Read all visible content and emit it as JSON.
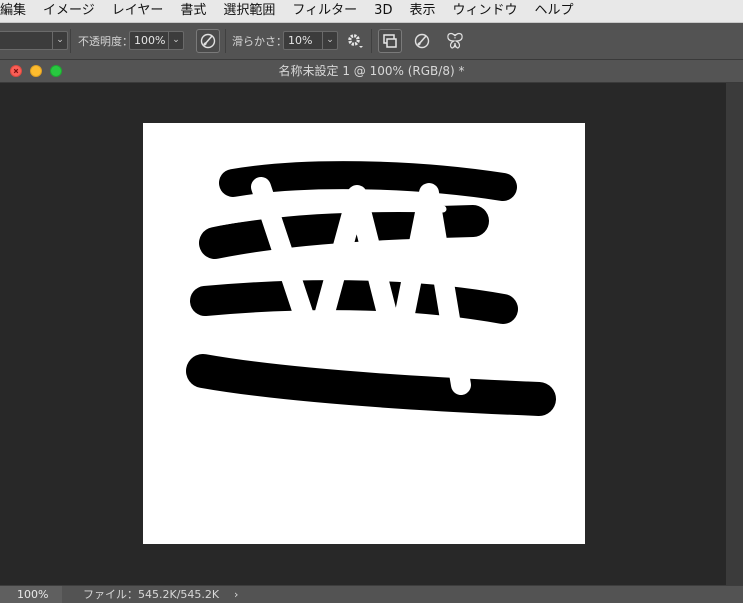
{
  "menubar": {
    "items": [
      "編集",
      "イメージ",
      "レイヤー",
      "書式",
      "選択範囲",
      "フィルター",
      "3D",
      "表示",
      "ウィンドウ",
      "ヘルプ"
    ]
  },
  "options": {
    "opacity_label": "不透明度：",
    "opacity_value": "100%",
    "smoothing_label": "滑らかさ：",
    "smoothing_value": "10%"
  },
  "document": {
    "title": "名称未設定 1 @ 100% (RGB/8) *"
  },
  "statusbar": {
    "zoom": "100%",
    "file_info": "ファイル：545.2K/545.2K",
    "arrow": "›"
  },
  "colors": {
    "menubar_bg": "#e8e8e8",
    "panel_bg": "#535353",
    "canvas_bg": "#282828",
    "artboard": "#ffffff",
    "paint_black": "#000000",
    "paint_white": "#ffffff"
  },
  "icons": [
    "brush-pressure-icon",
    "gear-icon",
    "symmetry-icon",
    "airbrush-icon",
    "butterfly-icon"
  ]
}
